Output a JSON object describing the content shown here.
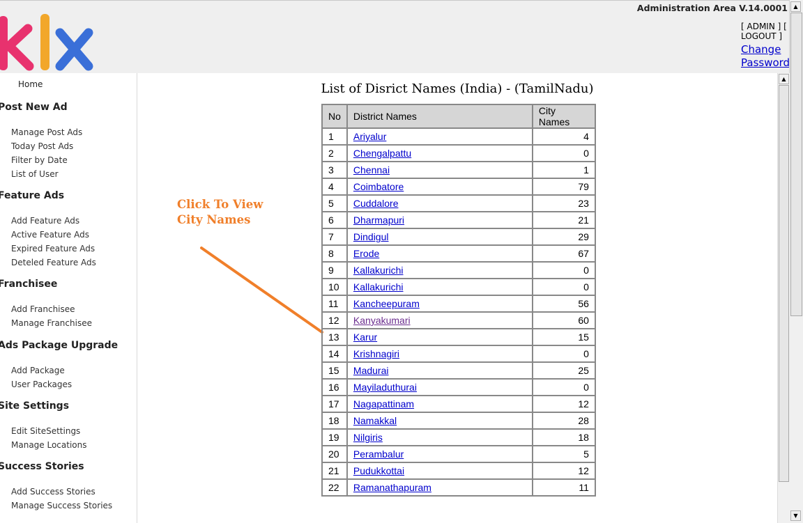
{
  "header": {
    "version": "Administration Area V.14.0001",
    "admin_text": "[ ADMIN ] [ LOGOUT ]",
    "change_password_line1": "Change",
    "change_password_line2": "Password"
  },
  "logo": {
    "text": "klx",
    "colors": {
      "k": "#e8326e",
      "l": "#f2a72a",
      "x": "#3a6fd8"
    }
  },
  "sidebar": {
    "home": "Home",
    "sections": [
      {
        "title": "Post New Ad",
        "items": [
          "Manage Post Ads",
          "Today Post Ads",
          "Filter by Date",
          "List of User"
        ]
      },
      {
        "title": "Feature Ads",
        "items": [
          "Add Feature Ads",
          "Active Feature Ads",
          "Expired Feature Ads",
          "Deteled Feature Ads"
        ]
      },
      {
        "title": "Franchisee",
        "items": [
          "Add Franchisee",
          "Manage Franchisee"
        ]
      },
      {
        "title": "Ads Package Upgrade",
        "items": [
          "Add Package",
          "User Packages"
        ]
      },
      {
        "title": "Site Settings",
        "items": [
          "Edit SiteSettings",
          "Manage Locations"
        ]
      },
      {
        "title": "Success Stories",
        "items": [
          "Add Success Stories",
          "Manage Success Stories"
        ]
      }
    ]
  },
  "main": {
    "title": "List of Disrict Names (India) - (TamilNadu)",
    "annotation_line1": "Click To View",
    "annotation_line2": "City Names",
    "annotation_color": "#f07f2a",
    "table": {
      "headers": [
        "No",
        "District Names",
        "City Names"
      ],
      "rows": [
        {
          "no": "1",
          "district": "Ariyalur",
          "cities": "4"
        },
        {
          "no": "2",
          "district": "Chengalpattu",
          "cities": "0"
        },
        {
          "no": "3",
          "district": "Chennai",
          "cities": "1"
        },
        {
          "no": "4",
          "district": "Coimbatore",
          "cities": "79"
        },
        {
          "no": "5",
          "district": "Cuddalore",
          "cities": "23"
        },
        {
          "no": "6",
          "district": "Dharmapuri",
          "cities": "21"
        },
        {
          "no": "7",
          "district": "Dindigul",
          "cities": "29"
        },
        {
          "no": "8",
          "district": "Erode",
          "cities": "67"
        },
        {
          "no": "9",
          "district": "Kallakurichi",
          "cities": "0"
        },
        {
          "no": "10",
          "district": "Kallakurichi",
          "cities": "0"
        },
        {
          "no": "11",
          "district": "Kancheepuram",
          "cities": "56"
        },
        {
          "no": "12",
          "district": "Kanyakumari",
          "cities": "60",
          "visited": true
        },
        {
          "no": "13",
          "district": "Karur",
          "cities": "15"
        },
        {
          "no": "14",
          "district": "Krishnagiri",
          "cities": "0"
        },
        {
          "no": "15",
          "district": "Madurai",
          "cities": "25"
        },
        {
          "no": "16",
          "district": "Mayiladuthurai",
          "cities": "0"
        },
        {
          "no": "17",
          "district": "Nagapattinam",
          "cities": "12"
        },
        {
          "no": "18",
          "district": "Namakkal",
          "cities": "28"
        },
        {
          "no": "19",
          "district": "Nilgiris",
          "cities": "18"
        },
        {
          "no": "20",
          "district": "Perambalur",
          "cities": "5"
        },
        {
          "no": "21",
          "district": "Pudukkottai",
          "cities": "12"
        },
        {
          "no": "22",
          "district": "Ramanathapuram",
          "cities": "11"
        }
      ]
    }
  },
  "scrollbars": {
    "outer": "vertical",
    "inner": "vertical"
  }
}
